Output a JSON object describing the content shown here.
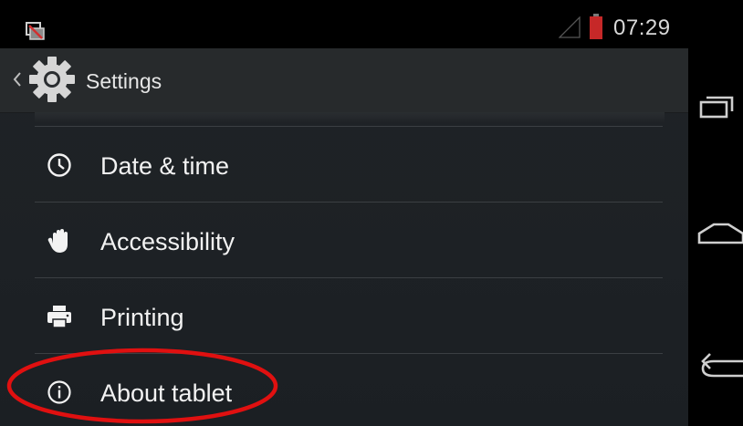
{
  "status_bar": {
    "time": "07:29",
    "left_icon": "screenshot-notification-icon",
    "signal_icon": "signal-empty-icon",
    "battery_icon": "battery-low-icon",
    "battery_color": "#c62828"
  },
  "action_bar": {
    "title": "Settings",
    "up_icon": "chevron-left-icon",
    "app_icon": "gear-icon"
  },
  "list": {
    "items": [
      {
        "label": "Date & time",
        "icon": "clock-icon"
      },
      {
        "label": "Accessibility",
        "icon": "hand-icon"
      },
      {
        "label": "Printing",
        "icon": "printer-icon"
      },
      {
        "label": "About tablet",
        "icon": "info-icon"
      }
    ]
  },
  "annotation": {
    "highlighted_item": "About tablet",
    "color": "#e01010"
  },
  "nav_bar": {
    "buttons": [
      {
        "icon": "recent-apps-icon"
      },
      {
        "icon": "home-icon"
      },
      {
        "icon": "back-icon"
      }
    ]
  }
}
